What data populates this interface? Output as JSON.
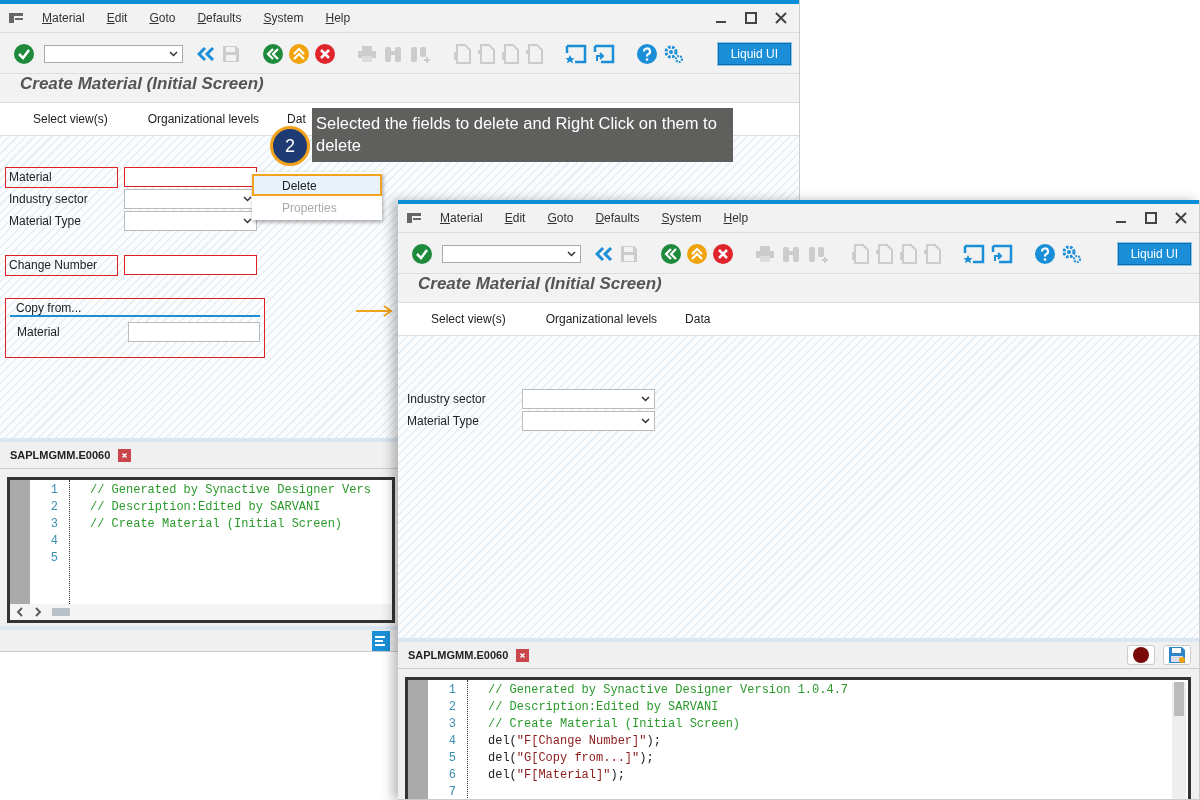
{
  "windows": [
    {
      "menu": [
        "Material",
        "Edit",
        "Goto",
        "Defaults",
        "System",
        "Help"
      ],
      "liquid_ui_button": "Liquid UI",
      "screen_title": "Create Material (Initial Screen)",
      "view_buttons": [
        "Select view(s)",
        "Organizational levels",
        "Dat"
      ],
      "field_groups": [
        [
          {
            "label": "Material",
            "kind": "input",
            "highlighted": true
          },
          {
            "label": "Industry sector",
            "kind": "dropdown",
            "highlighted": false
          },
          {
            "label": "Material Type",
            "kind": "dropdown",
            "highlighted": false
          }
        ],
        [
          {
            "label": "Change Number",
            "kind": "input",
            "highlighted": true
          }
        ]
      ],
      "group_box": {
        "title": "Copy from...",
        "highlighted": true,
        "fields": [
          {
            "label": "Material",
            "kind": "input",
            "highlighted": false
          }
        ]
      },
      "editor": {
        "tab": "SAPLMGMM.E0060",
        "lines": [
          {
            "number": "1",
            "kind": "comment",
            "code": "// Generated by Synactive Designer Vers"
          },
          {
            "number": "2",
            "kind": "comment",
            "code": "// Description:Edited by SARVANI"
          },
          {
            "number": "3",
            "kind": "comment",
            "code": "// Create Material (Initial Screen)"
          },
          {
            "number": "4",
            "kind": "blank"
          },
          {
            "number": "5",
            "kind": "blank"
          }
        ]
      }
    },
    {
      "menu": [
        "Material",
        "Edit",
        "Goto",
        "Defaults",
        "System",
        "Help"
      ],
      "liquid_ui_button": "Liquid UI",
      "screen_title": "Create Material (Initial Screen)",
      "view_buttons": [
        "Select view(s)",
        "Organizational levels",
        "Data"
      ],
      "field_groups": [
        [
          {
            "label": "Industry sector",
            "kind": "dropdown",
            "highlighted": false
          },
          {
            "label": "Material Type",
            "kind": "dropdown",
            "highlighted": false
          }
        ]
      ],
      "editor": {
        "tab": "SAPLMGMM.E0060",
        "lines": [
          {
            "number": "1",
            "kind": "comment",
            "code": "// Generated by Synactive Designer Version 1.0.4.7"
          },
          {
            "number": "2",
            "kind": "comment",
            "code": "// Description:Edited by SARVANI"
          },
          {
            "number": "3",
            "kind": "comment",
            "code": "// Create Material (Initial Screen)"
          },
          {
            "number": "4",
            "kind": "statement",
            "code": "del(\"F[Change Number]\");"
          },
          {
            "number": "5",
            "kind": "statement",
            "code": "del(\"G[Copy from...]\");"
          },
          {
            "number": "6",
            "kind": "statement",
            "code": "del(\"F[Material]\");"
          },
          {
            "number": "7",
            "kind": "blank"
          }
        ]
      }
    }
  ],
  "context_menu": {
    "items": [
      {
        "label": "Delete",
        "selected": true,
        "disabled": false
      },
      {
        "label": "Properties",
        "selected": false,
        "disabled": true
      }
    ]
  },
  "callout": {
    "step": "2",
    "text": "Selected the fields to delete and Right Click on them to delete"
  }
}
